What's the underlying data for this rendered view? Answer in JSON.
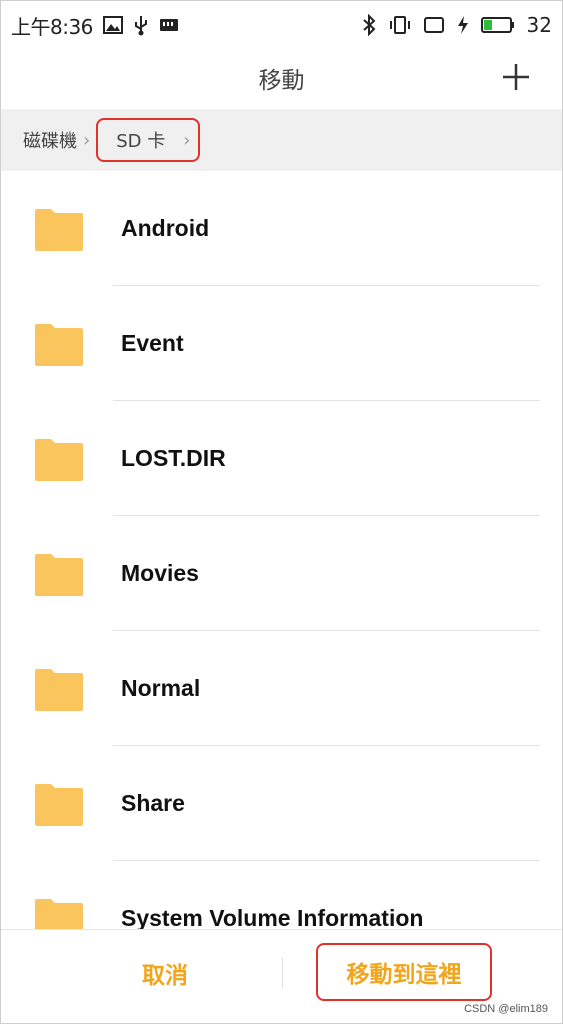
{
  "status_bar": {
    "time": "上午8:36",
    "battery_level": "32",
    "battery_fill_fraction": 0.32,
    "left_icons": [
      "image-icon",
      "usb-icon",
      "sd-card-icon"
    ],
    "right_icons": [
      "bluetooth-icon",
      "vibrate-icon",
      "screen-icon",
      "charging-icon",
      "battery-icon"
    ]
  },
  "header": {
    "title": "移動",
    "add_icon": "plus-icon"
  },
  "breadcrumb": {
    "root_label": "磁碟機",
    "current_label": "SD 卡",
    "separator": "›"
  },
  "folders": [
    {
      "name": "Android",
      "icon": "folder-icon"
    },
    {
      "name": "Event",
      "icon": "folder-icon"
    },
    {
      "name": "LOST.DIR",
      "icon": "folder-icon"
    },
    {
      "name": "Movies",
      "icon": "folder-icon"
    },
    {
      "name": "Normal",
      "icon": "folder-icon"
    },
    {
      "name": "Share",
      "icon": "folder-icon"
    },
    {
      "name": "System Volume Information",
      "icon": "folder-icon"
    }
  ],
  "footer": {
    "cancel_label": "取消",
    "move_here_label": "移動到這裡",
    "watermark": "CSDN @elim189"
  },
  "colors": {
    "accent": "#f2a51c",
    "folder": "#fbc55e",
    "highlight_border": "#e0322b",
    "breadcrumb_bg": "#f0f0f0"
  }
}
